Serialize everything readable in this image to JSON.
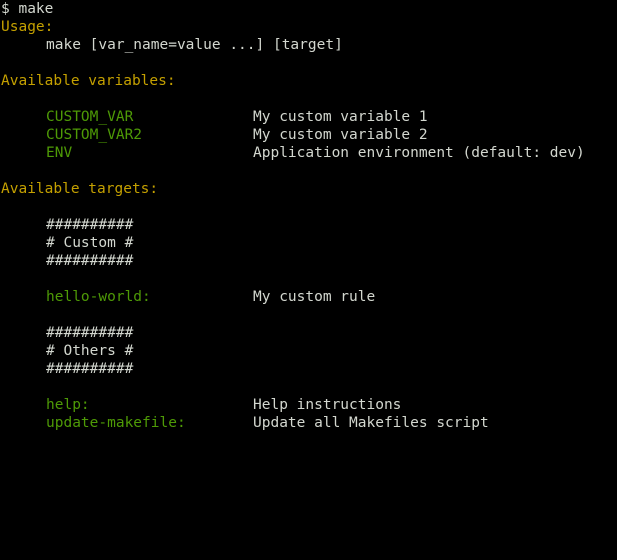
{
  "colors": {
    "background": "#000000",
    "text": "#d3d7cf",
    "heading": "#c4a000",
    "name": "#4e9a06"
  },
  "prompt": "$ make",
  "usage": {
    "heading": "Usage:",
    "command": "make [var_name=value ...] [target]"
  },
  "variables": {
    "heading": "Available variables:",
    "items": [
      {
        "name": "CUSTOM_VAR",
        "description": "My custom variable 1"
      },
      {
        "name": "CUSTOM_VAR2",
        "description": "My custom variable 2"
      },
      {
        "name": "ENV",
        "description": "Application environment (default: dev)"
      }
    ]
  },
  "targets": {
    "heading": "Available targets:",
    "groups": [
      {
        "banner_top": "##########",
        "banner_title": "# Custom #",
        "banner_bottom": "##########",
        "items": [
          {
            "name": "hello-world:",
            "description": "My custom rule"
          }
        ]
      },
      {
        "banner_top": "##########",
        "banner_title": "# Others #",
        "banner_bottom": "##########",
        "items": [
          {
            "name": "help:",
            "description": "Help instructions"
          },
          {
            "name": "update-makefile:",
            "description": "Update all Makefiles script"
          }
        ]
      }
    ]
  }
}
